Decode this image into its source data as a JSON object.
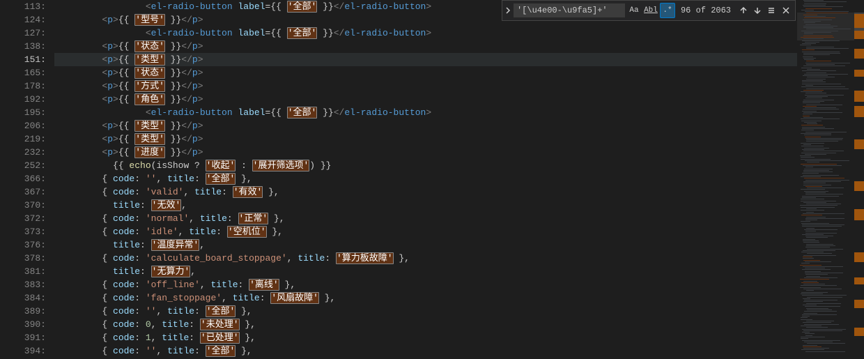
{
  "find": {
    "expand_icon": "chevron-right",
    "value": "'[\\u4e00-\\u9fa5]+'",
    "case_label": "Aa",
    "word_label": "Abl",
    "regex_label": ".*",
    "regex_on": true,
    "count": "96 of 2063",
    "prev_icon": "arrow-up",
    "next_icon": "arrow-down",
    "selection_icon": "menu",
    "close_icon": "x"
  },
  "current_line_index": 3,
  "lines": [
    {
      "num": "113:",
      "indent": 16,
      "segs": [
        {
          "t": "tag",
          "v": "<"
        },
        {
          "t": "tagname",
          "v": "el-radio-button"
        },
        {
          "t": "plain",
          "v": " "
        },
        {
          "t": "attr",
          "v": "label"
        },
        {
          "t": "plain",
          "v": "={{ "
        },
        {
          "t": "hi",
          "v": "'全部'"
        },
        {
          "t": "plain",
          "v": " }}"
        },
        {
          "t": "tag",
          "v": "</"
        },
        {
          "t": "tagname",
          "v": "el-radio-button"
        },
        {
          "t": "tag",
          "v": ">"
        }
      ]
    },
    {
      "num": "124:",
      "indent": 8,
      "segs": [
        {
          "t": "tag",
          "v": "<"
        },
        {
          "t": "tagname",
          "v": "p"
        },
        {
          "t": "tag",
          "v": ">"
        },
        {
          "t": "plain",
          "v": "{{ "
        },
        {
          "t": "hi",
          "v": "'型号'"
        },
        {
          "t": "plain",
          "v": " }}"
        },
        {
          "t": "tag",
          "v": "</"
        },
        {
          "t": "tagname",
          "v": "p"
        },
        {
          "t": "tag",
          "v": ">"
        }
      ]
    },
    {
      "num": "127:",
      "indent": 16,
      "segs": [
        {
          "t": "tag",
          "v": "<"
        },
        {
          "t": "tagname",
          "v": "el-radio-button"
        },
        {
          "t": "plain",
          "v": " "
        },
        {
          "t": "attr",
          "v": "label"
        },
        {
          "t": "plain",
          "v": "={{ "
        },
        {
          "t": "hi",
          "v": "'全部'"
        },
        {
          "t": "plain",
          "v": " }}"
        },
        {
          "t": "tag",
          "v": "</"
        },
        {
          "t": "tagname",
          "v": "el-radio-button"
        },
        {
          "t": "tag",
          "v": ">"
        }
      ]
    },
    {
      "num": "138:",
      "indent": 8,
      "segs": [
        {
          "t": "tag",
          "v": "<"
        },
        {
          "t": "tagname",
          "v": "p"
        },
        {
          "t": "tag",
          "v": ">"
        },
        {
          "t": "plain",
          "v": "{{ "
        },
        {
          "t": "hi",
          "v": "'状态'"
        },
        {
          "t": "plain",
          "v": " }}"
        },
        {
          "t": "tag",
          "v": "</"
        },
        {
          "t": "tagname",
          "v": "p"
        },
        {
          "t": "tag",
          "v": ">"
        }
      ]
    },
    {
      "num": "151:",
      "indent": 8,
      "segs": [
        {
          "t": "tag",
          "v": "<"
        },
        {
          "t": "tagname",
          "v": "p"
        },
        {
          "t": "tag",
          "v": ">"
        },
        {
          "t": "plain",
          "v": "{{ "
        },
        {
          "t": "selhi",
          "v": "'类型'"
        },
        {
          "t": "plain",
          "v": " }}"
        },
        {
          "t": "tag",
          "v": "</"
        },
        {
          "t": "tagname",
          "v": "p"
        },
        {
          "t": "tag",
          "v": ">"
        }
      ]
    },
    {
      "num": "165:",
      "indent": 8,
      "segs": [
        {
          "t": "tag",
          "v": "<"
        },
        {
          "t": "tagname",
          "v": "p"
        },
        {
          "t": "tag",
          "v": ">"
        },
        {
          "t": "plain",
          "v": "{{ "
        },
        {
          "t": "hi",
          "v": "'状态'"
        },
        {
          "t": "plain",
          "v": " }}"
        },
        {
          "t": "tag",
          "v": "</"
        },
        {
          "t": "tagname",
          "v": "p"
        },
        {
          "t": "tag",
          "v": ">"
        }
      ]
    },
    {
      "num": "178:",
      "indent": 8,
      "segs": [
        {
          "t": "tag",
          "v": "<"
        },
        {
          "t": "tagname",
          "v": "p"
        },
        {
          "t": "tag",
          "v": ">"
        },
        {
          "t": "plain",
          "v": "{{ "
        },
        {
          "t": "hi",
          "v": "'方式'"
        },
        {
          "t": "plain",
          "v": " }}"
        },
        {
          "t": "tag",
          "v": "</"
        },
        {
          "t": "tagname",
          "v": "p"
        },
        {
          "t": "tag",
          "v": ">"
        }
      ]
    },
    {
      "num": "192:",
      "indent": 8,
      "segs": [
        {
          "t": "tag",
          "v": "<"
        },
        {
          "t": "tagname",
          "v": "p"
        },
        {
          "t": "tag",
          "v": ">"
        },
        {
          "t": "plain",
          "v": "{{ "
        },
        {
          "t": "hi",
          "v": "'角色'"
        },
        {
          "t": "plain",
          "v": " }}"
        },
        {
          "t": "tag",
          "v": "</"
        },
        {
          "t": "tagname",
          "v": "p"
        },
        {
          "t": "tag",
          "v": ">"
        }
      ]
    },
    {
      "num": "195:",
      "indent": 16,
      "segs": [
        {
          "t": "tag",
          "v": "<"
        },
        {
          "t": "tagname",
          "v": "el-radio-button"
        },
        {
          "t": "plain",
          "v": " "
        },
        {
          "t": "attr",
          "v": "label"
        },
        {
          "t": "plain",
          "v": "={{ "
        },
        {
          "t": "hi",
          "v": "'全部'"
        },
        {
          "t": "plain",
          "v": " }}"
        },
        {
          "t": "tag",
          "v": "</"
        },
        {
          "t": "tagname",
          "v": "el-radio-button"
        },
        {
          "t": "tag",
          "v": ">"
        }
      ]
    },
    {
      "num": "206:",
      "indent": 8,
      "segs": [
        {
          "t": "tag",
          "v": "<"
        },
        {
          "t": "tagname",
          "v": "p"
        },
        {
          "t": "tag",
          "v": ">"
        },
        {
          "t": "plain",
          "v": "{{ "
        },
        {
          "t": "hi",
          "v": "'类型'"
        },
        {
          "t": "plain",
          "v": " }}"
        },
        {
          "t": "tag",
          "v": "</"
        },
        {
          "t": "tagname",
          "v": "p"
        },
        {
          "t": "tag",
          "v": ">"
        }
      ]
    },
    {
      "num": "219:",
      "indent": 8,
      "segs": [
        {
          "t": "tag",
          "v": "<"
        },
        {
          "t": "tagname",
          "v": "p"
        },
        {
          "t": "tag",
          "v": ">"
        },
        {
          "t": "plain",
          "v": "{{ "
        },
        {
          "t": "hi",
          "v": "'类型'"
        },
        {
          "t": "plain",
          "v": " }}"
        },
        {
          "t": "tag",
          "v": "</"
        },
        {
          "t": "tagname",
          "v": "p"
        },
        {
          "t": "tag",
          "v": ">"
        }
      ]
    },
    {
      "num": "232:",
      "indent": 8,
      "segs": [
        {
          "t": "tag",
          "v": "<"
        },
        {
          "t": "tagname",
          "v": "p"
        },
        {
          "t": "tag",
          "v": ">"
        },
        {
          "t": "plain",
          "v": "{{ "
        },
        {
          "t": "hi",
          "v": "'进度'"
        },
        {
          "t": "plain",
          "v": " }}"
        },
        {
          "t": "tag",
          "v": "</"
        },
        {
          "t": "tagname",
          "v": "p"
        },
        {
          "t": "tag",
          "v": ">"
        }
      ]
    },
    {
      "num": "252:",
      "indent": 10,
      "segs": [
        {
          "t": "plain",
          "v": "{{ "
        },
        {
          "t": "fn",
          "v": "echo"
        },
        {
          "t": "plain",
          "v": "(isShow ? "
        },
        {
          "t": "hi",
          "v": "'收起'"
        },
        {
          "t": "plain",
          "v": " : "
        },
        {
          "t": "hi",
          "v": "'展开筛选项'"
        },
        {
          "t": "plain",
          "v": ") }}"
        }
      ]
    },
    {
      "num": "366:",
      "indent": 8,
      "segs": [
        {
          "t": "plain",
          "v": "{ "
        },
        {
          "t": "prop",
          "v": "code"
        },
        {
          "t": "plain",
          "v": ": "
        },
        {
          "t": "str",
          "v": "''"
        },
        {
          "t": "plain",
          "v": ", "
        },
        {
          "t": "prop",
          "v": "title"
        },
        {
          "t": "plain",
          "v": ": "
        },
        {
          "t": "hi",
          "v": "'全部'"
        },
        {
          "t": "plain",
          "v": " },"
        }
      ]
    },
    {
      "num": "367:",
      "indent": 8,
      "segs": [
        {
          "t": "plain",
          "v": "{ "
        },
        {
          "t": "prop",
          "v": "code"
        },
        {
          "t": "plain",
          "v": ": "
        },
        {
          "t": "str",
          "v": "'valid'"
        },
        {
          "t": "plain",
          "v": ", "
        },
        {
          "t": "prop",
          "v": "title"
        },
        {
          "t": "plain",
          "v": ": "
        },
        {
          "t": "hi",
          "v": "'有效'"
        },
        {
          "t": "plain",
          "v": " },"
        }
      ]
    },
    {
      "num": "370:",
      "indent": 10,
      "segs": [
        {
          "t": "prop",
          "v": "title"
        },
        {
          "t": "plain",
          "v": ": "
        },
        {
          "t": "hi",
          "v": "'无效'"
        },
        {
          "t": "plain",
          "v": ","
        }
      ]
    },
    {
      "num": "372:",
      "indent": 8,
      "segs": [
        {
          "t": "plain",
          "v": "{ "
        },
        {
          "t": "prop",
          "v": "code"
        },
        {
          "t": "plain",
          "v": ": "
        },
        {
          "t": "str",
          "v": "'normal'"
        },
        {
          "t": "plain",
          "v": ", "
        },
        {
          "t": "prop",
          "v": "title"
        },
        {
          "t": "plain",
          "v": ": "
        },
        {
          "t": "hi",
          "v": "'正常'"
        },
        {
          "t": "plain",
          "v": " },"
        }
      ]
    },
    {
      "num": "373:",
      "indent": 8,
      "segs": [
        {
          "t": "plain",
          "v": "{ "
        },
        {
          "t": "prop",
          "v": "code"
        },
        {
          "t": "plain",
          "v": ": "
        },
        {
          "t": "str",
          "v": "'idle'"
        },
        {
          "t": "plain",
          "v": ", "
        },
        {
          "t": "prop",
          "v": "title"
        },
        {
          "t": "plain",
          "v": ": "
        },
        {
          "t": "hi",
          "v": "'空机位'"
        },
        {
          "t": "plain",
          "v": " },"
        }
      ]
    },
    {
      "num": "376:",
      "indent": 10,
      "segs": [
        {
          "t": "prop",
          "v": "title"
        },
        {
          "t": "plain",
          "v": ": "
        },
        {
          "t": "hi",
          "v": "'温度异常'"
        },
        {
          "t": "plain",
          "v": ","
        }
      ]
    },
    {
      "num": "378:",
      "indent": 8,
      "segs": [
        {
          "t": "plain",
          "v": "{ "
        },
        {
          "t": "prop",
          "v": "code"
        },
        {
          "t": "plain",
          "v": ": "
        },
        {
          "t": "str",
          "v": "'calculate_board_stoppage'"
        },
        {
          "t": "plain",
          "v": ", "
        },
        {
          "t": "prop",
          "v": "title"
        },
        {
          "t": "plain",
          "v": ": "
        },
        {
          "t": "hi",
          "v": "'算力板故障'"
        },
        {
          "t": "plain",
          "v": " },"
        }
      ]
    },
    {
      "num": "381:",
      "indent": 10,
      "segs": [
        {
          "t": "prop",
          "v": "title"
        },
        {
          "t": "plain",
          "v": ": "
        },
        {
          "t": "hi",
          "v": "'无算力'"
        },
        {
          "t": "plain",
          "v": ","
        }
      ]
    },
    {
      "num": "383:",
      "indent": 8,
      "segs": [
        {
          "t": "plain",
          "v": "{ "
        },
        {
          "t": "prop",
          "v": "code"
        },
        {
          "t": "plain",
          "v": ": "
        },
        {
          "t": "str",
          "v": "'off_line'"
        },
        {
          "t": "plain",
          "v": ", "
        },
        {
          "t": "prop",
          "v": "title"
        },
        {
          "t": "plain",
          "v": ": "
        },
        {
          "t": "hi",
          "v": "'离线'"
        },
        {
          "t": "plain",
          "v": " },"
        }
      ]
    },
    {
      "num": "384:",
      "indent": 8,
      "segs": [
        {
          "t": "plain",
          "v": "{ "
        },
        {
          "t": "prop",
          "v": "code"
        },
        {
          "t": "plain",
          "v": ": "
        },
        {
          "t": "str",
          "v": "'fan_stoppage'"
        },
        {
          "t": "plain",
          "v": ", "
        },
        {
          "t": "prop",
          "v": "title"
        },
        {
          "t": "plain",
          "v": ": "
        },
        {
          "t": "hi",
          "v": "'风扇故障'"
        },
        {
          "t": "plain",
          "v": " },"
        }
      ]
    },
    {
      "num": "389:",
      "indent": 8,
      "segs": [
        {
          "t": "plain",
          "v": "{ "
        },
        {
          "t": "prop",
          "v": "code"
        },
        {
          "t": "plain",
          "v": ": "
        },
        {
          "t": "str",
          "v": "''"
        },
        {
          "t": "plain",
          "v": ", "
        },
        {
          "t": "prop",
          "v": "title"
        },
        {
          "t": "plain",
          "v": ": "
        },
        {
          "t": "hi",
          "v": "'全部'"
        },
        {
          "t": "plain",
          "v": " },"
        }
      ]
    },
    {
      "num": "390:",
      "indent": 8,
      "segs": [
        {
          "t": "plain",
          "v": "{ "
        },
        {
          "t": "prop",
          "v": "code"
        },
        {
          "t": "plain",
          "v": ": "
        },
        {
          "t": "num",
          "v": "0"
        },
        {
          "t": "plain",
          "v": ", "
        },
        {
          "t": "prop",
          "v": "title"
        },
        {
          "t": "plain",
          "v": ": "
        },
        {
          "t": "hi",
          "v": "'未处理'"
        },
        {
          "t": "plain",
          "v": " },"
        }
      ]
    },
    {
      "num": "391:",
      "indent": 8,
      "segs": [
        {
          "t": "plain",
          "v": "{ "
        },
        {
          "t": "prop",
          "v": "code"
        },
        {
          "t": "plain",
          "v": ": "
        },
        {
          "t": "num",
          "v": "1"
        },
        {
          "t": "plain",
          "v": ", "
        },
        {
          "t": "prop",
          "v": "title"
        },
        {
          "t": "plain",
          "v": ": "
        },
        {
          "t": "hi",
          "v": "'已处理'"
        },
        {
          "t": "plain",
          "v": " },"
        }
      ]
    },
    {
      "num": "394:",
      "indent": 8,
      "segs": [
        {
          "t": "plain",
          "v": "{ "
        },
        {
          "t": "prop",
          "v": "code"
        },
        {
          "t": "plain",
          "v": ": "
        },
        {
          "t": "str",
          "v": "''"
        },
        {
          "t": "plain",
          "v": ", "
        },
        {
          "t": "prop",
          "v": "title"
        },
        {
          "t": "plain",
          "v": ": "
        },
        {
          "t": "hi",
          "v": "'全部'"
        },
        {
          "t": "plain",
          "v": " },"
        }
      ]
    }
  ]
}
